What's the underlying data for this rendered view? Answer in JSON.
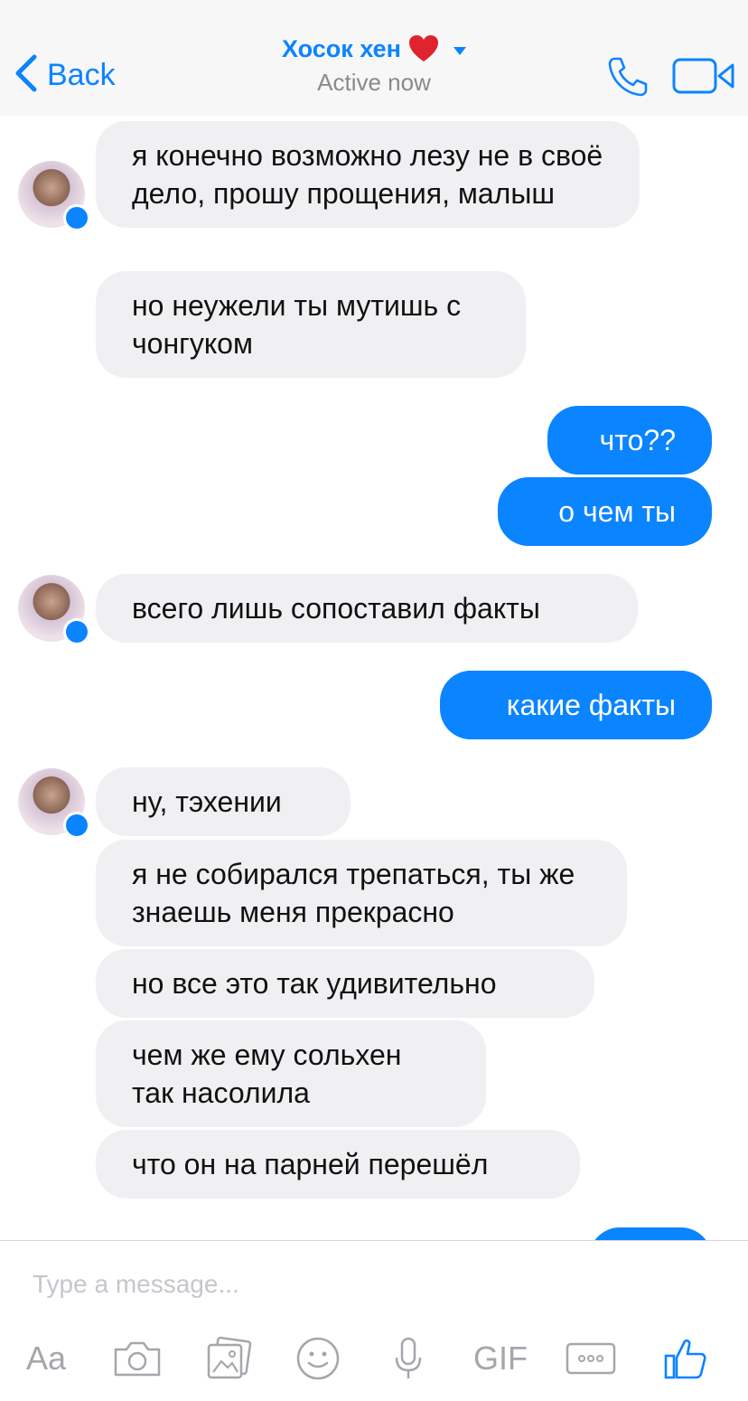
{
  "header": {
    "back_label": "Back",
    "contact_name": "Хосок хен",
    "status": "Active now"
  },
  "colors": {
    "accent": "#0b84ff",
    "incoming_bubble": "#f0f0f2",
    "heart": "#e0242f"
  },
  "messages": [
    {
      "dir": "in",
      "text": "я конечно возможно лезу не в своё дело, прошу прощения, малыш"
    },
    {
      "dir": "in",
      "text": "но неужели ты мутишь с чонгуком"
    },
    {
      "dir": "out",
      "text": "что??"
    },
    {
      "dir": "out",
      "text": "о чем ты"
    },
    {
      "dir": "in",
      "text": "всего лишь сопоставил факты"
    },
    {
      "dir": "out",
      "text": "какие факты"
    },
    {
      "dir": "in",
      "text": "ну, тэхении"
    },
    {
      "dir": "in",
      "text": "я не собирался трепаться, ты же знаешь меня прекрасно"
    },
    {
      "dir": "in",
      "text": "но все это так удивительно"
    },
    {
      "dir": "in",
      "text": "чем же ему сольхен так насолила"
    },
    {
      "dir": "in",
      "text": "что он на парней перешёл"
    }
  ],
  "composer": {
    "placeholder": "Type a message...",
    "aa_label": "Aa",
    "gif_label": "GIF",
    "icons": [
      "text-format-icon",
      "camera-icon",
      "photo-icon",
      "emoji-icon",
      "microphone-icon",
      "gif-icon",
      "more-icon",
      "thumbs-up-icon"
    ]
  }
}
